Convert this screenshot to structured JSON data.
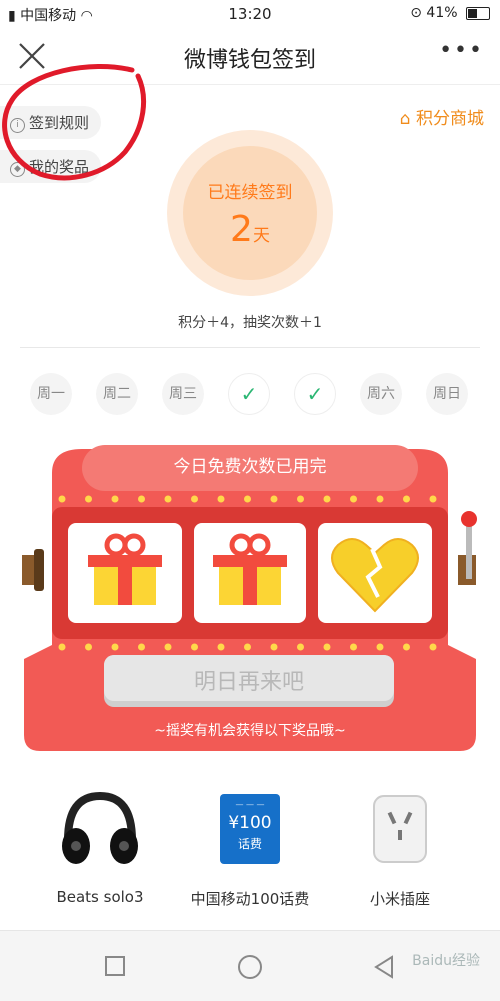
{
  "status_bar": {
    "carrier": "中国移动",
    "time": "13:20",
    "battery": "41%",
    "battery_level": 0.41
  },
  "header": {
    "title": "微博钱包签到",
    "more": "•••"
  },
  "links": {
    "rules": "签到规则",
    "prizes": "我的奖品",
    "shop": "积分商城"
  },
  "streak": {
    "label": "已连续签到",
    "days": "2",
    "unit": "天"
  },
  "reward_text": "积分＋4，抽奖次数＋1",
  "week": [
    {
      "label": "周一",
      "checked": false
    },
    {
      "label": "周二",
      "checked": false
    },
    {
      "label": "周三",
      "checked": false
    },
    {
      "label": "周四",
      "checked": true
    },
    {
      "label": "周五",
      "checked": true
    },
    {
      "label": "周六",
      "checked": false
    },
    {
      "label": "周日",
      "checked": false
    }
  ],
  "machine": {
    "banner": "今日免费次数已用完",
    "reels": [
      "gift-icon",
      "gift-icon",
      "broken-heart-icon"
    ],
    "button": "明日再来吧",
    "hint": "~摇奖有机会获得以下奖品哦~"
  },
  "prizes": [
    {
      "name": "Beats solo3",
      "icon": "headphones-icon"
    },
    {
      "name": "中国移动100话费",
      "icon": "phone-card-icon",
      "card_value": "¥100",
      "card_sub": "话费"
    },
    {
      "name": "小米插座",
      "icon": "smart-plug-icon"
    }
  ],
  "watermark": "Baidu经验",
  "colors": {
    "orange": "#ff7a1a",
    "machine_red": "#f25a55",
    "check_green": "#2bb673",
    "shop_orange": "#f08c1c"
  }
}
